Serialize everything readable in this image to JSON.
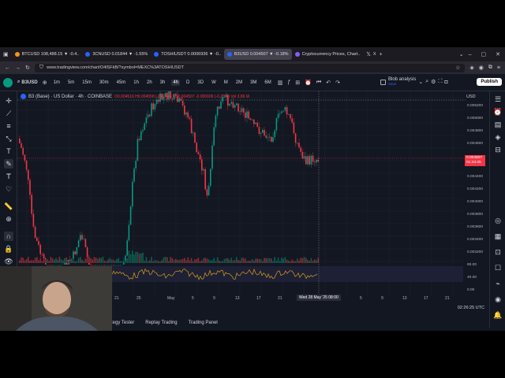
{
  "browser": {
    "tabs": [
      {
        "label": "BTCUSD 108,488.15 ▼ -0.4..",
        "color": "#f7931a"
      },
      {
        "label": "3CNUSD 0.01844 ▼ -1.55%",
        "color": "#2962ff"
      },
      {
        "label": "TOSHIUSDT 0.0006936 ▼ -0..",
        "color": "#2962ff"
      },
      {
        "label": "B3USD 0.004507 ▼ -0.18%",
        "color": "#2962ff"
      },
      {
        "label": "Cryptocurrency Prices, Chart..",
        "color": "#8b5cf6"
      },
      {
        "label": "X",
        "color": "#000000"
      }
    ],
    "url": "www.tradingview.com/chart/O4lSFkB/?symbol=MEXC%3ATOSHIUSDT"
  },
  "toolbar": {
    "symbol": "B3USD",
    "timeframes": [
      "1m",
      "5m",
      "15m",
      "30m",
      "45m",
      "1h",
      "2h",
      "3h",
      "4h",
      "D",
      "3D",
      "W",
      "M",
      "2M",
      "3M",
      "6M"
    ],
    "active_timeframe": "4h",
    "blob_label": "Blob analysis",
    "blob_sub": "Save",
    "publish": "Publish"
  },
  "legend": {
    "title": "B3 (Base) · US Dollar · 4h · COINBASE",
    "ohlc": "O0.004516  H0.004558  L0.004447  C0.004507  -0.000009 (-0.20%)  Vol 3.86 M"
  },
  "price_axis": {
    "currency": "USD",
    "ticks": [
      "0.005400",
      "0.005200",
      "0.005000",
      "0.004800",
      "0.004600",
      "0.004400",
      "0.004200",
      "0.004000",
      "0.003800",
      "0.003600",
      "0.003400",
      "0.003200",
      "0.003000"
    ],
    "rsi_ticks": [
      "80.00",
      "60.00",
      "40.00",
      "20.00"
    ],
    "last_price": "0.004507",
    "countdown": "01:33:35",
    "bottom_value": "0.00"
  },
  "time_axis": {
    "labels": [
      "21",
      "25",
      "May",
      "5",
      "9",
      "13",
      "17",
      "21",
      "5",
      "9",
      "13",
      "17",
      "21"
    ],
    "crosshair": "Wed 28 May '25   08:00",
    "clock": "02:26:25 UTC"
  },
  "bottom_tabs": [
    "Strategy Tester",
    "Replay Trading",
    "Trading Panel"
  ],
  "chart_data": {
    "type": "candlestick",
    "ylim": [
      0.003,
      0.0055
    ]
  },
  "colors": {
    "up": "#089981",
    "down": "#f23645",
    "rsi": "#d4a017",
    "bg": "#131722"
  }
}
